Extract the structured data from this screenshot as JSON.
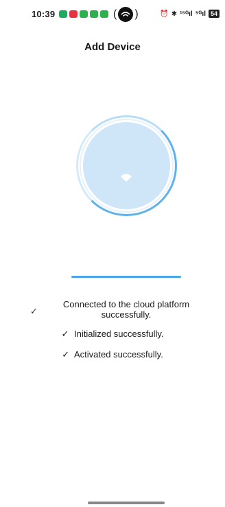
{
  "status_bar": {
    "time": "10:39",
    "notif_colors": [
      "#1faa62",
      "#e9323f",
      "#2bb24c",
      "#2bb24c",
      "#2bb24c"
    ],
    "hotspot_suffix": ")",
    "network_1": "¹⁵ᴳ",
    "network_2": "⁵ᴳ",
    "battery": "54"
  },
  "header": {
    "title": "Add Device"
  },
  "progress": {
    "value": 1.0,
    "color": "#4aa8e6"
  },
  "steps": [
    {
      "check": "✓",
      "label": "Connected to the cloud platform successfully."
    },
    {
      "check": "✓",
      "label": "Initialized successfully."
    },
    {
      "check": "✓",
      "label": "Activated successfully."
    }
  ]
}
